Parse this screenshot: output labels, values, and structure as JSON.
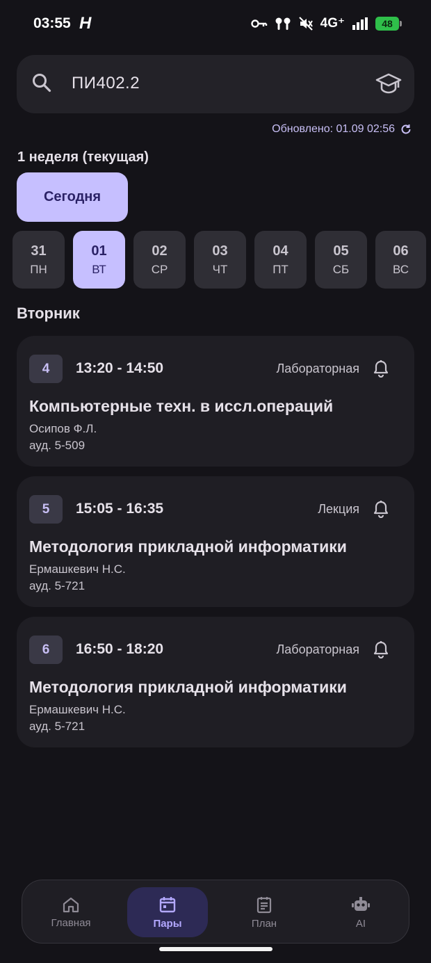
{
  "status": {
    "time": "03:55",
    "h_label": "H",
    "network": "4G⁺",
    "battery": "48"
  },
  "search": {
    "value": "ПИ402.2"
  },
  "updated": "Обновлено: 01.09 02:56",
  "week_title": "1 неделя (текущая)",
  "today_label": "Сегодня",
  "days": [
    {
      "num": "31",
      "wd": "ПН"
    },
    {
      "num": "01",
      "wd": "ВТ"
    },
    {
      "num": "02",
      "wd": "СР"
    },
    {
      "num": "03",
      "wd": "ЧТ"
    },
    {
      "num": "04",
      "wd": "ПТ"
    },
    {
      "num": "05",
      "wd": "СБ"
    },
    {
      "num": "06",
      "wd": "ВС"
    }
  ],
  "selected_day": "01",
  "day_title": "Вторник",
  "lessons": [
    {
      "num": "4",
      "time": "13:20 - 14:50",
      "type": "Лабораторная",
      "subject": "Компьютерные техн. в иссл.операций",
      "teacher": "Осипов Ф.Л.",
      "room": "ауд. 5-509"
    },
    {
      "num": "5",
      "time": "15:05 - 16:35",
      "type": "Лекция",
      "subject": "Методология прикладной информатики",
      "teacher": "Ермашкевич Н.С.",
      "room": "ауд. 5-721"
    },
    {
      "num": "6",
      "time": "16:50 - 18:20",
      "type": "Лабораторная",
      "subject": "Методология прикладной информатики",
      "teacher": "Ермашкевич Н.С.",
      "room": "ауд. 5-721"
    }
  ],
  "nav": [
    {
      "label": "Главная",
      "icon": "home-icon"
    },
    {
      "label": "Пары",
      "icon": "calendar-icon"
    },
    {
      "label": "План",
      "icon": "plan-icon"
    },
    {
      "label": "AI",
      "icon": "robot-icon"
    }
  ],
  "active_nav": "Пары",
  "colors": {
    "background": "#141318",
    "accent": "#c6bfff",
    "card": "#1f1e24"
  }
}
